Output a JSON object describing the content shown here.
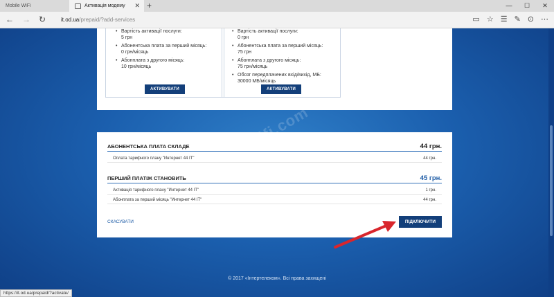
{
  "browser": {
    "tabs": [
      {
        "label": "Mobile WiFi"
      },
      {
        "label": "Активація модему"
      }
    ],
    "url_host": "it.od.ua",
    "url_path": "/prepaid/?add-services",
    "status_url": "https://it.od.ua/prepaid/?activate/"
  },
  "plans": [
    {
      "features": [
        {
          "label": "Вартість активації послуги:",
          "value": "5 грн"
        },
        {
          "label": "Абонентська плата за перший місяць:",
          "value": "0 грн/місяць"
        },
        {
          "label": "Абонплата з другого місяць:",
          "value": "10 грн/місяць"
        }
      ],
      "button": "АКТИВУВАТИ"
    },
    {
      "features": [
        {
          "label": "Вартість активації послуги:",
          "value": "0 грн"
        },
        {
          "label": "Абонентська плата за перший місяць:",
          "value": "75 грн"
        },
        {
          "label": "Абонплата з другого місяць:",
          "value": "75 грн/місяць"
        },
        {
          "label": "Обсяг передплачених вхід/вихід, МБ:",
          "value": "30000 МБ/місяць"
        }
      ],
      "button": "АКТИВУВАТИ"
    }
  ],
  "summary": {
    "section1": {
      "title": "АБОНЕНТСЬКА ПЛАТА СКЛАДЕ",
      "amount": "44 грн.",
      "rows": [
        {
          "desc": "Оплата тарифного плану \"Интернет 44 IT\"",
          "price": "44 грн."
        }
      ]
    },
    "section2": {
      "title": "ПЕРШИЙ ПЛАТІЖ СТАНОВИТЬ",
      "amount": "45 грн.",
      "rows": [
        {
          "desc": "Активація тарифного плану \"Интернет 44 IT\"",
          "price": "1 грн."
        },
        {
          "desc": "Абонплата за перший місяць \"Интернет 44 IT\"",
          "price": "44 грн."
        }
      ]
    },
    "cancel": "СКАСУВАТИ",
    "connect": "ПІДКЛЮЧИТИ"
  },
  "watermark": "help-wifi.com",
  "footer": "© 2017 «Інтертелеком». Всі права захищені",
  "colors": {
    "accent": "#133f7a",
    "page_bg": "#1b5fae",
    "arrow": "#d9262c"
  }
}
